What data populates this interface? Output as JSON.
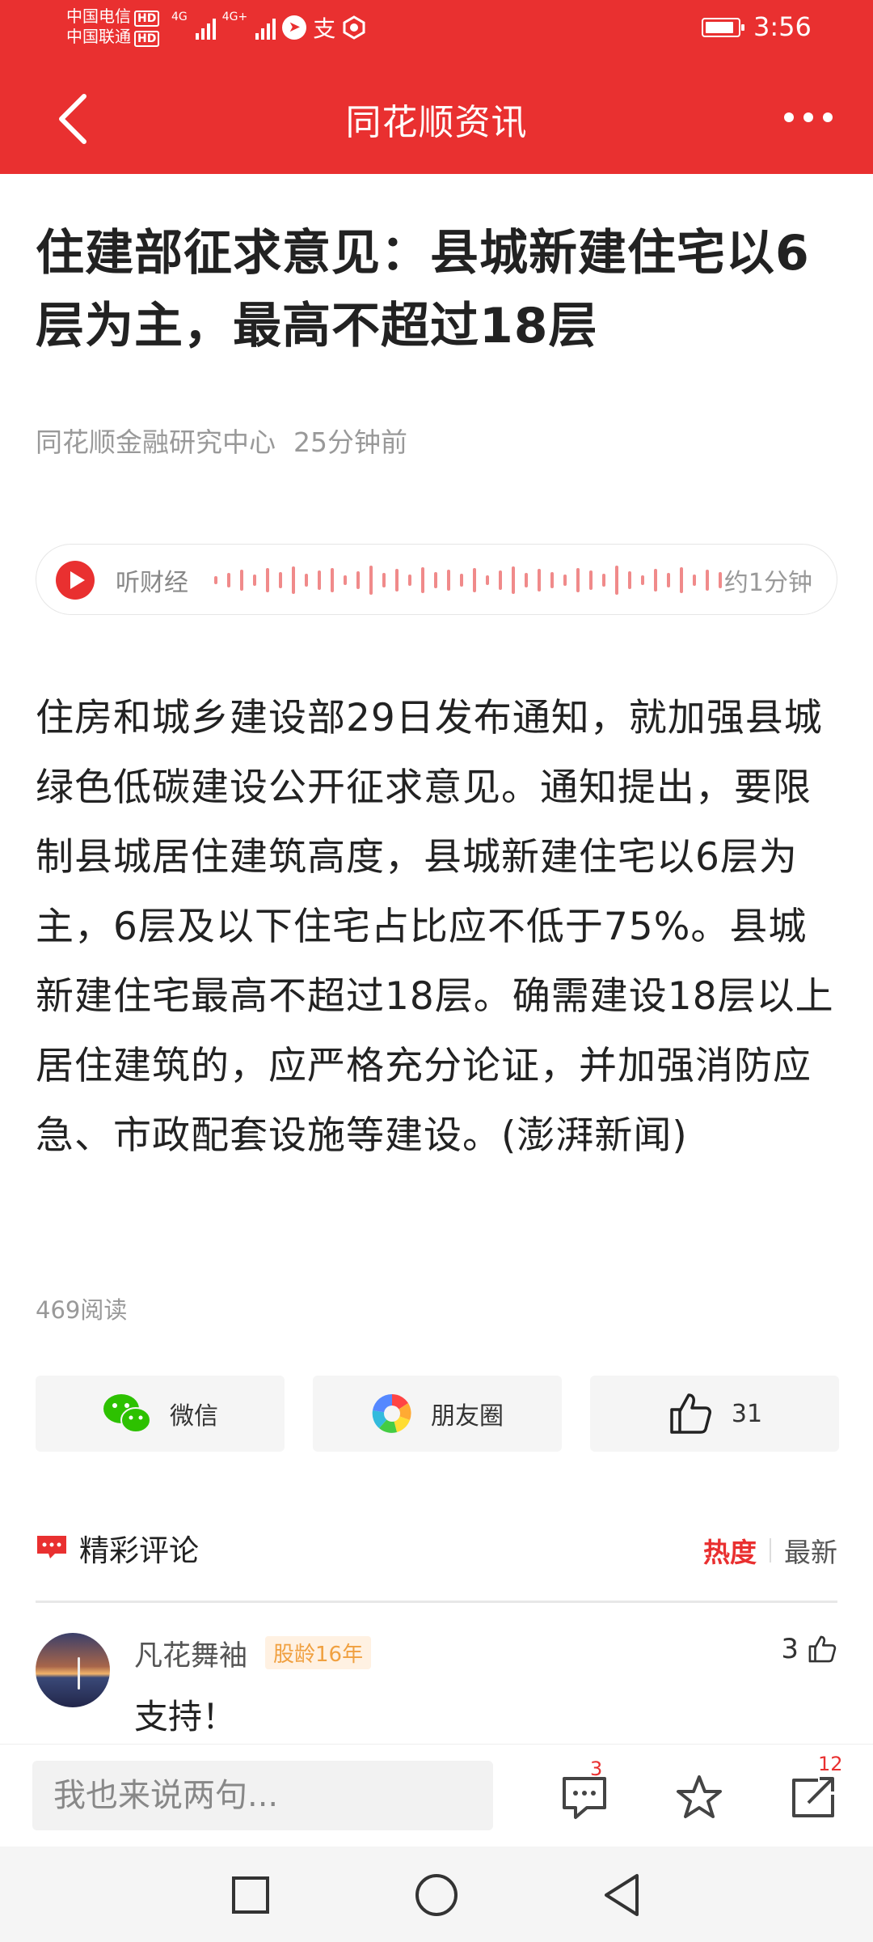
{
  "status_bar": {
    "carrier1": "中国电信",
    "carrier2": "中国联通",
    "hd_badge": "HD",
    "signal1_label": "4G",
    "signal2_label": "4G+",
    "battery_level": 0.9,
    "time": "3:56"
  },
  "nav": {
    "title": "同花顺资讯",
    "back_icon": "back-chevron-icon",
    "more_icon": "more-dots-icon"
  },
  "article": {
    "title": "住建部征求意见：县城新建住宅以6层为主，最高不超过18层",
    "source": "同花顺金融研究中心",
    "time_ago": "25分钟前",
    "body": "住房和城乡建设部29日发布通知，就加强县城绿色低碳建设公开征求意见。通知提出，要限制县城居住建筑高度，县城新建住宅以6层为主，6层及以下住宅占比应不低于75%。县城新建住宅最高不超过18层。确需建设18层以上居住建筑的，应严格充分论证，并加强消防应急、市政配套设施等建设。(澎湃新闻)",
    "read_count": "469阅读"
  },
  "audio": {
    "label": "听财经",
    "duration": "约1分钟",
    "accent": "#e93030"
  },
  "share": {
    "wechat": "微信",
    "moments": "朋友圈",
    "likes": "31"
  },
  "comments": {
    "title": "精彩评论",
    "sort_hot": "热度",
    "sort_new": "最新",
    "items": [
      {
        "user": "凡花舞袖",
        "badge": "股龄16年",
        "likes": "3",
        "text": "支持！"
      }
    ]
  },
  "input_bar": {
    "placeholder": "我也来说两句...",
    "comment_count": "3",
    "share_count": "12"
  },
  "colors": {
    "brand_red": "#e93030",
    "badge_orange": "#f0a040"
  }
}
